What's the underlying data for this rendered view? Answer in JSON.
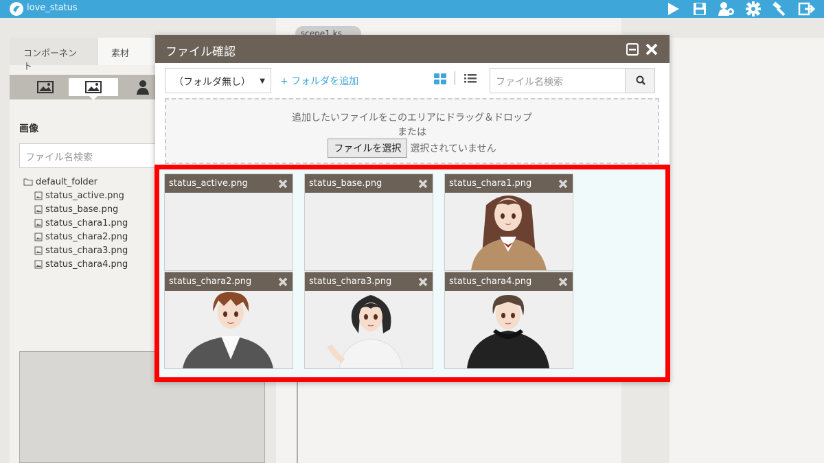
{
  "app": {
    "title": "love_status"
  },
  "toolbar": {
    "icons": [
      "play-icon",
      "save-icon",
      "users-icon",
      "gear-icon",
      "hammer-icon",
      "export-icon"
    ]
  },
  "left_panel": {
    "tabs": [
      "コンポーネント",
      "素材"
    ],
    "heading": "画像",
    "search_placeholder": "ファイル名検索",
    "folder": "default_folder",
    "files": [
      "status_active.png",
      "status_base.png",
      "status_chara1.png",
      "status_chara2.png",
      "status_chara3.png",
      "status_chara4.png"
    ]
  },
  "editor": {
    "tab_label": "scene1.ks"
  },
  "dialog": {
    "title": "ファイル確認",
    "folder_select": "（フォルダ無し）",
    "add_folder": "+ フォルダを追加",
    "search_placeholder": "ファイル名検索",
    "dropzone_line1": "追加したいファイルをこのエリアにドラッグ＆ドロップ",
    "dropzone_line2": "または",
    "choose_button": "ファイルを選択",
    "no_file_selected": "選択されていません",
    "cards": [
      {
        "name": "status_active.png",
        "kind": "blank"
      },
      {
        "name": "status_base.png",
        "kind": "blank"
      },
      {
        "name": "status_chara1.png",
        "kind": "girl-long-hair"
      },
      {
        "name": "status_chara2.png",
        "kind": "boy-brown"
      },
      {
        "name": "status_chara3.png",
        "kind": "girl-short-hair"
      },
      {
        "name": "status_chara4.png",
        "kind": "boy-hoodie"
      }
    ]
  }
}
